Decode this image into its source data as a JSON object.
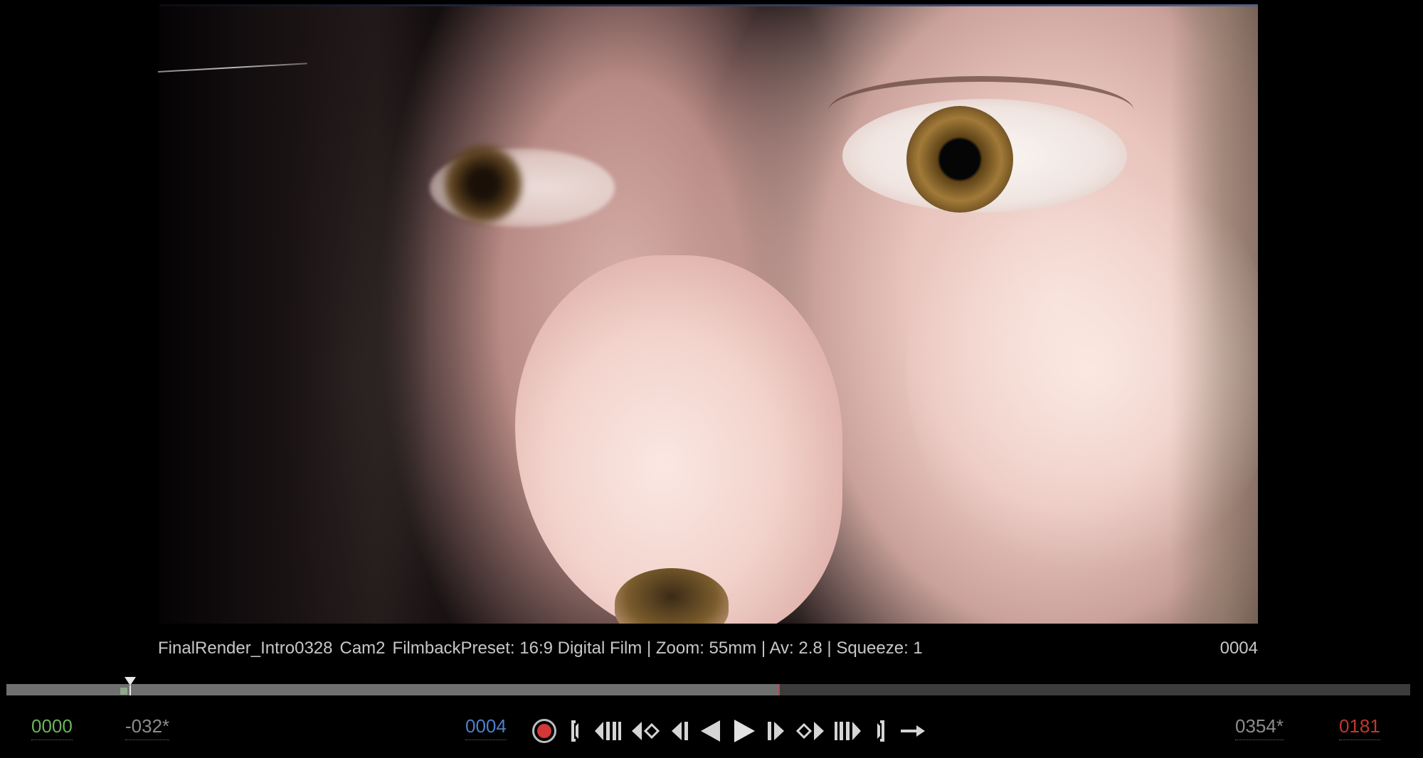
{
  "viewer": {
    "shot_name": "FinalRender_Intro0328",
    "camera": "Cam2",
    "camera_details": "FilmbackPreset: 16:9 Digital Film | Zoom: 55mm | Av: 2.8 | Squeeze: 1",
    "frame_number": "0004"
  },
  "timeline": {
    "progress_fraction": 0.55,
    "playhead_fraction": 0.088
  },
  "timecodes": {
    "start": "0000",
    "offset": "-032*",
    "current": "0004",
    "duration": "0354*",
    "end": "0181"
  },
  "transport_icons": [
    "record-icon",
    "go-to-start-icon",
    "previous-keyframe-icon",
    "previous-key-diamond-icon",
    "step-back-icon",
    "play-reverse-icon",
    "play-icon",
    "step-forward-icon",
    "next-key-diamond-icon",
    "next-keyframe-icon",
    "go-to-end-icon",
    "loop-arrow-icon"
  ],
  "colors": {
    "start_tc": "#6db35c",
    "current_tc": "#4e7fc9",
    "end_tc": "#c0392b",
    "record": "#d23838"
  }
}
